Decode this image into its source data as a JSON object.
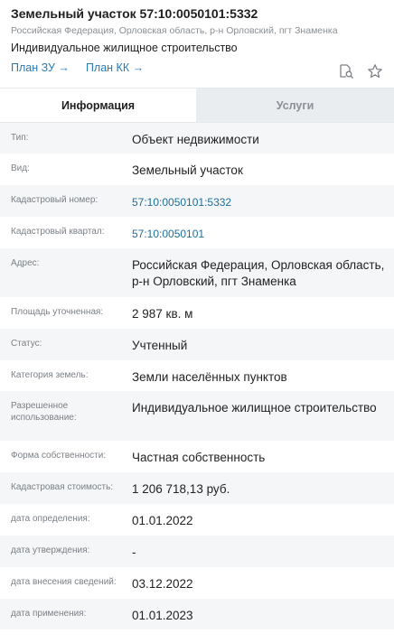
{
  "header": {
    "title": "Земельный участок 57:10:0050101:5332",
    "address_short": "Российская Федерация, Орловская область, р-н Орловский, пгт Знаменка",
    "purpose": "Индивидуальное жилищное строительство",
    "links": [
      {
        "label": "План ЗУ →"
      },
      {
        "label": "План КК →"
      }
    ],
    "icons": [
      "document-search-icon",
      "star-icon"
    ]
  },
  "tabs": [
    {
      "label": "Информация",
      "active": true
    },
    {
      "label": "Услуги",
      "active": false
    }
  ],
  "rows": [
    {
      "label": "Тип:",
      "value": "Объект недвижимости"
    },
    {
      "label": "Вид:",
      "value": "Земельный участок"
    },
    {
      "label": "Кадастровый номер:",
      "value": "57:10:0050101:5332",
      "link": true
    },
    {
      "label": "Кадастровый квартал:",
      "value": "57:10:0050101",
      "link": true
    },
    {
      "label": "Адрес:",
      "value": "Российская Федерация, Орловская область, р-н Орловский, пгт Знаменка"
    },
    {
      "label": "Площадь уточненная:",
      "value": "2 987 кв. м"
    },
    {
      "label": "Статус:",
      "value": "Учтенный"
    },
    {
      "label": "Категория земель:",
      "value": "Земли населённых пунктов"
    },
    {
      "label": "Разрешенное использование:",
      "value": "Индивидуальное жилищное строительство"
    },
    {
      "label": "Форма собственности:",
      "value": "Частная собственность"
    },
    {
      "label": "Кадастровая стоимость:",
      "value": "1 206 718,13 руб."
    },
    {
      "label": "дата определения:",
      "value": "01.01.2022"
    },
    {
      "label": "дата утверждения:",
      "value": "-"
    },
    {
      "label": "дата внесения сведений:",
      "value": "03.12.2022"
    },
    {
      "label": "дата применения:",
      "value": "01.01.2023"
    }
  ]
}
